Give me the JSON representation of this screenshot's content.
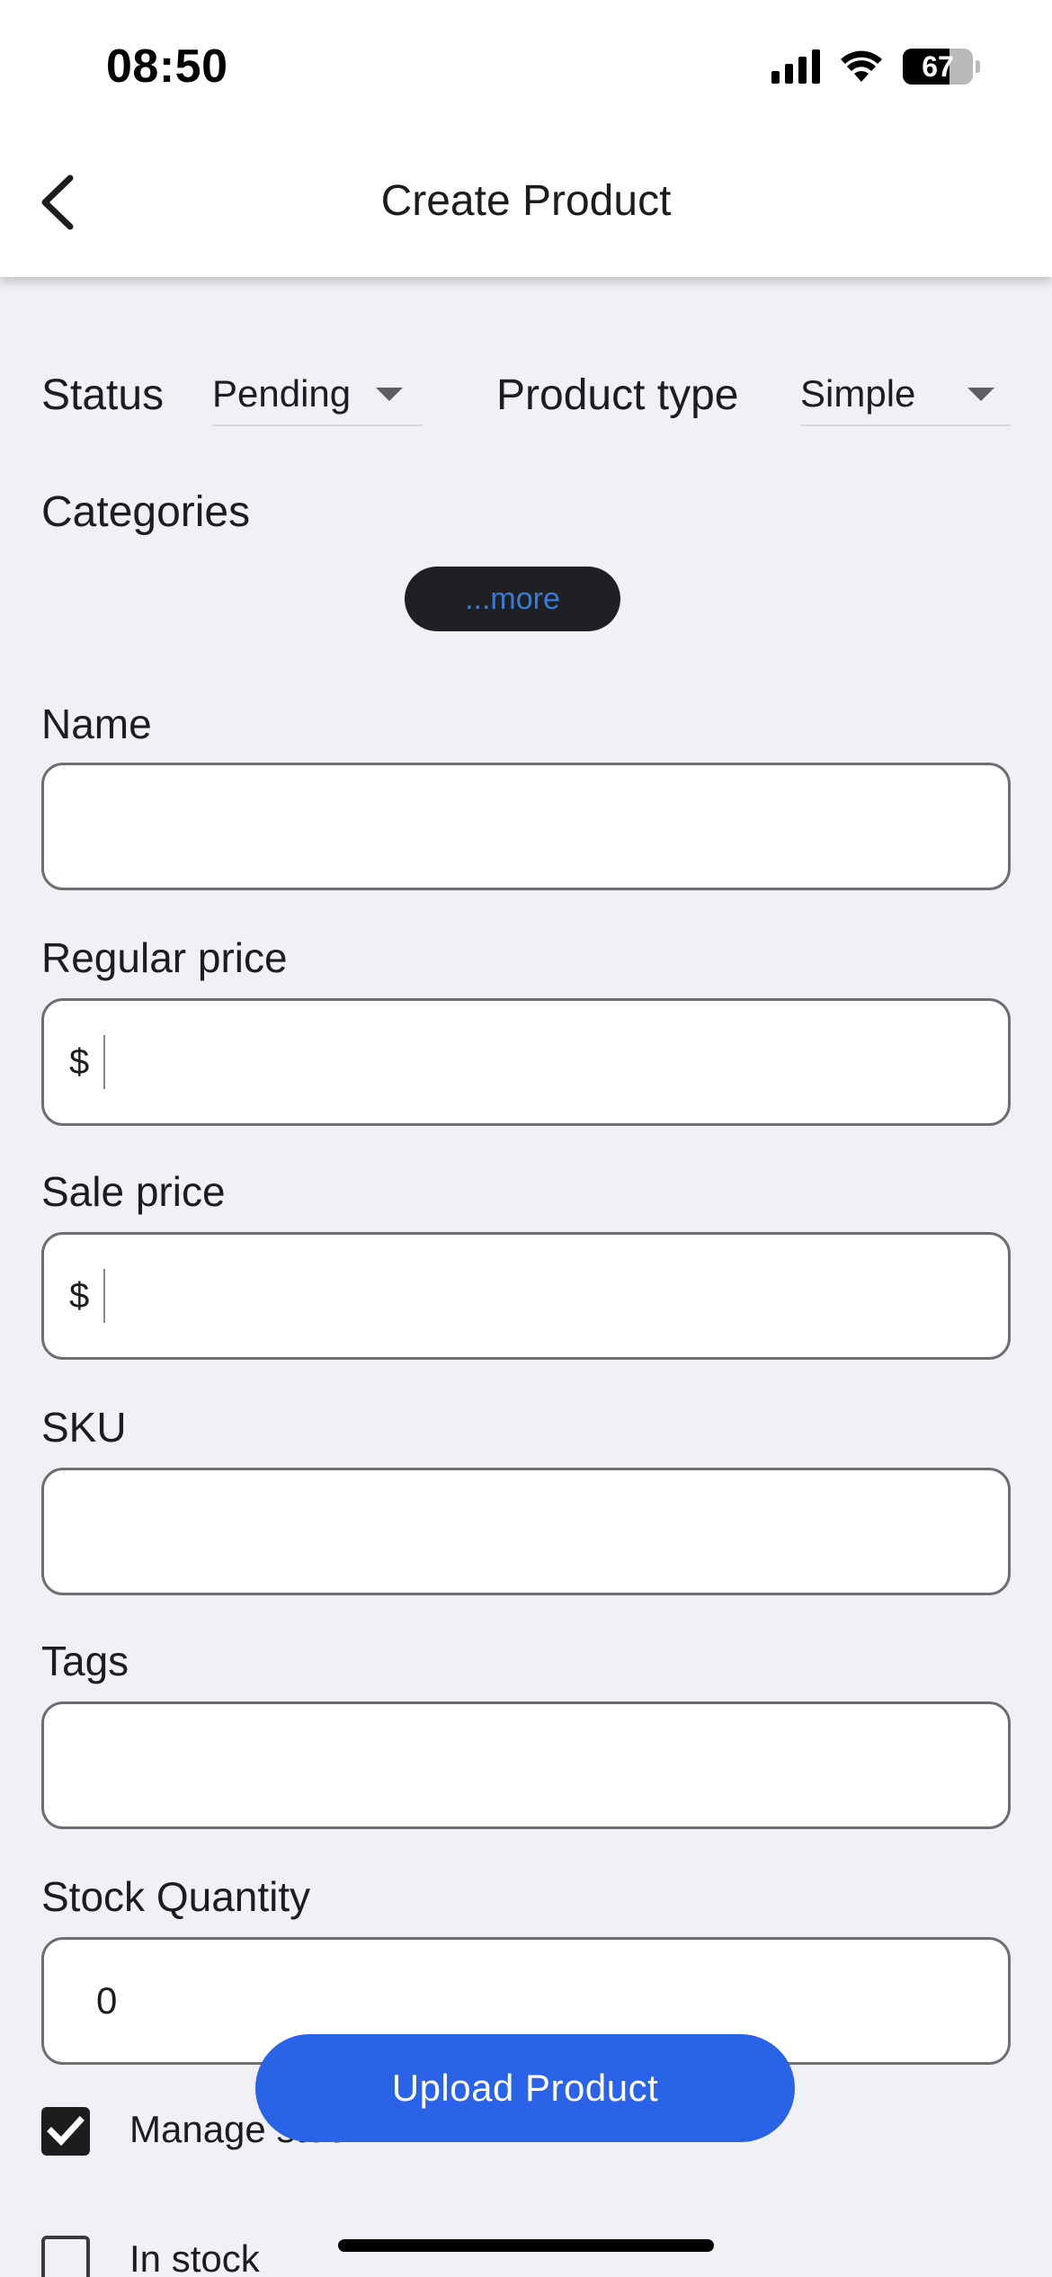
{
  "status_bar": {
    "time": "08:50",
    "battery_level": "67",
    "battery_fraction": 0.67,
    "icons": [
      "signal-icon",
      "wifi-icon",
      "battery-icon"
    ]
  },
  "app_bar": {
    "title": "Create Product",
    "back_icon": "chevron-left-icon"
  },
  "form": {
    "status": {
      "label": "Status",
      "value": "Pending"
    },
    "product_type": {
      "label": "Product type",
      "value": "Simple"
    },
    "categories": {
      "label": "Categories",
      "more_label": "...more"
    },
    "name": {
      "label": "Name",
      "value": ""
    },
    "regular_price": {
      "label": "Regular price",
      "prefix": "$",
      "value": ""
    },
    "sale_price": {
      "label": "Sale price",
      "prefix": "$",
      "value": ""
    },
    "sku": {
      "label": "SKU",
      "value": ""
    },
    "tags": {
      "label": "Tags",
      "value": ""
    },
    "stock_quantity": {
      "label": "Stock Quantity",
      "value": "0"
    },
    "manage_stock": {
      "label": "Manage stock",
      "checked": true
    },
    "in_stock": {
      "label": "In stock",
      "checked": false
    }
  },
  "actions": {
    "upload_label": "Upload Product"
  },
  "colors": {
    "accent": "#2a63e8",
    "background": "#f0f0f5",
    "chip_bg": "#1e2024",
    "chip_text": "#3a7bd5"
  }
}
